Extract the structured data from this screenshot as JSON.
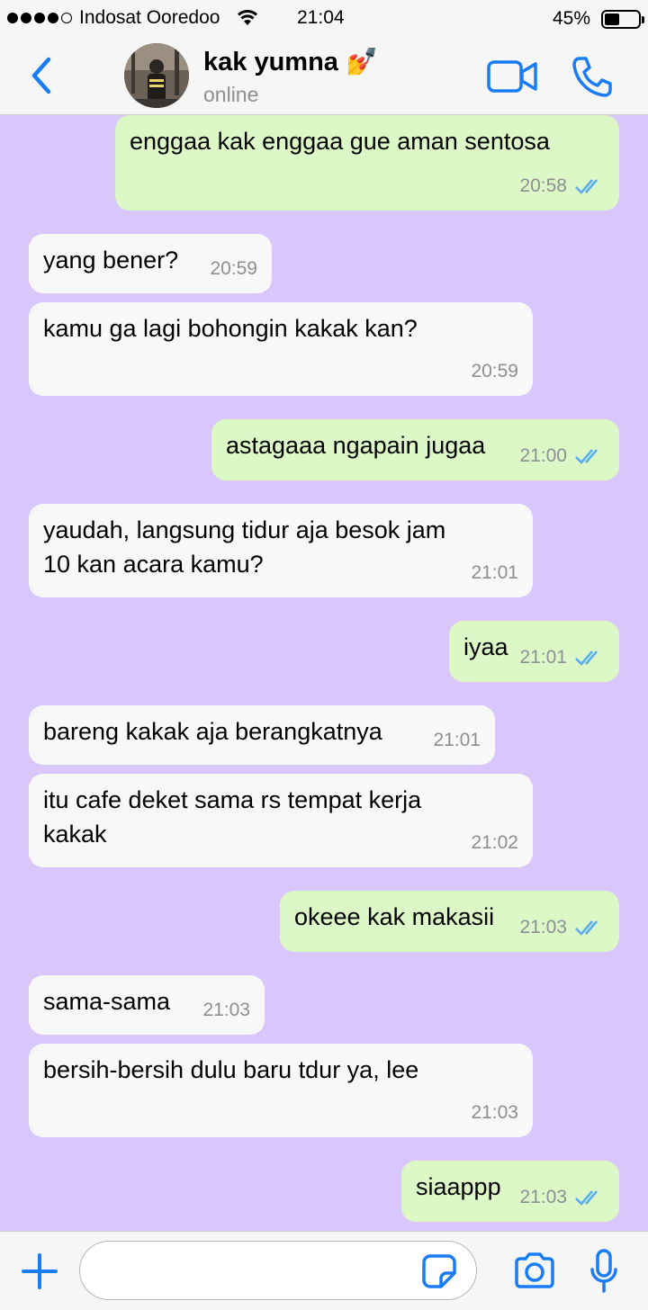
{
  "status_bar": {
    "carrier": "Indosat Ooredoo",
    "time": "21:04",
    "battery_percent": "45%",
    "battery_level": 0.45
  },
  "header": {
    "contact_name": "kak yumna 💅",
    "contact_status": "online"
  },
  "colors": {
    "accent": "#1a7cf5",
    "background": "#d9c6fb",
    "outgoing_bubble": "#dcf8c6",
    "incoming_bubble": "#f8f8f8",
    "read_ticks": "#5aaef0"
  },
  "messages": [
    {
      "dir": "out",
      "lines": [
        "enggaa kak enggaa gue aman sentosa"
      ],
      "time": "20:58"
    },
    {
      "dir": "in",
      "lines": [
        "yang bener?"
      ],
      "time": "20:59"
    },
    {
      "dir": "in",
      "lines": [
        "kamu ga lagi bohongin kakak kan?"
      ],
      "time": "20:59"
    },
    {
      "dir": "out",
      "lines": [
        "astagaaa ngapain jugaa"
      ],
      "time": "21:00"
    },
    {
      "dir": "in",
      "lines": [
        "yaudah, langsung tidur aja besok jam",
        "10 kan acara kamu?"
      ],
      "time": "21:01"
    },
    {
      "dir": "out",
      "lines": [
        "iyaa"
      ],
      "time": "21:01"
    },
    {
      "dir": "in",
      "lines": [
        "bareng kakak aja berangkatnya"
      ],
      "time": "21:01"
    },
    {
      "dir": "in",
      "lines": [
        "itu cafe deket sama rs tempat kerja",
        "kakak"
      ],
      "time": "21:02"
    },
    {
      "dir": "out",
      "lines": [
        "okeee kak makasii"
      ],
      "time": "21:03"
    },
    {
      "dir": "in",
      "lines": [
        "sama-sama"
      ],
      "time": "21:03"
    },
    {
      "dir": "in",
      "lines": [
        "bersih-bersih dulu baru tdur ya, lee"
      ],
      "time": "21:03"
    },
    {
      "dir": "out",
      "lines": [
        "siaappp"
      ],
      "time": "21:03"
    }
  ],
  "icons": {
    "back": "chevron-left-icon",
    "video_call": "video-camera-icon",
    "voice_call": "phone-icon",
    "attach": "plus-icon",
    "sticker": "sticker-icon",
    "camera": "camera-icon",
    "microphone": "microphone-icon"
  }
}
